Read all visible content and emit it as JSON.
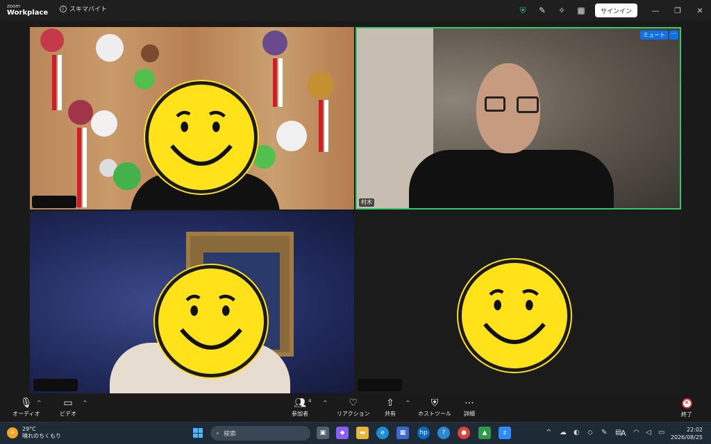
{
  "titlebar": {
    "logo_line1": "zoom",
    "logo_line2": "Workplace",
    "meeting_label": "スキマバイト",
    "signin": "サインイン"
  },
  "tiles": {
    "tile2_name": "村木",
    "mute_badge": "ミュート",
    "more_badge": "···"
  },
  "toolbar": {
    "audio": "オーディオ",
    "video": "ビデオ",
    "participants": "参加者",
    "participants_count": "4",
    "reactions": "リアクション",
    "share": "共有",
    "host_tools": "ホストツール",
    "details": "詳細",
    "end": "終了"
  },
  "taskbar": {
    "temperature": "29°C",
    "weather": "晴れのちくもり",
    "search_placeholder": "検索",
    "time": "22:02",
    "date": "2026/08/25"
  },
  "colors": {
    "active_speaker_border": "#2fcb6f",
    "mute_badge_bg": "#0e71eb",
    "smiley": "#ffe21a",
    "end_red": "#e02828"
  }
}
